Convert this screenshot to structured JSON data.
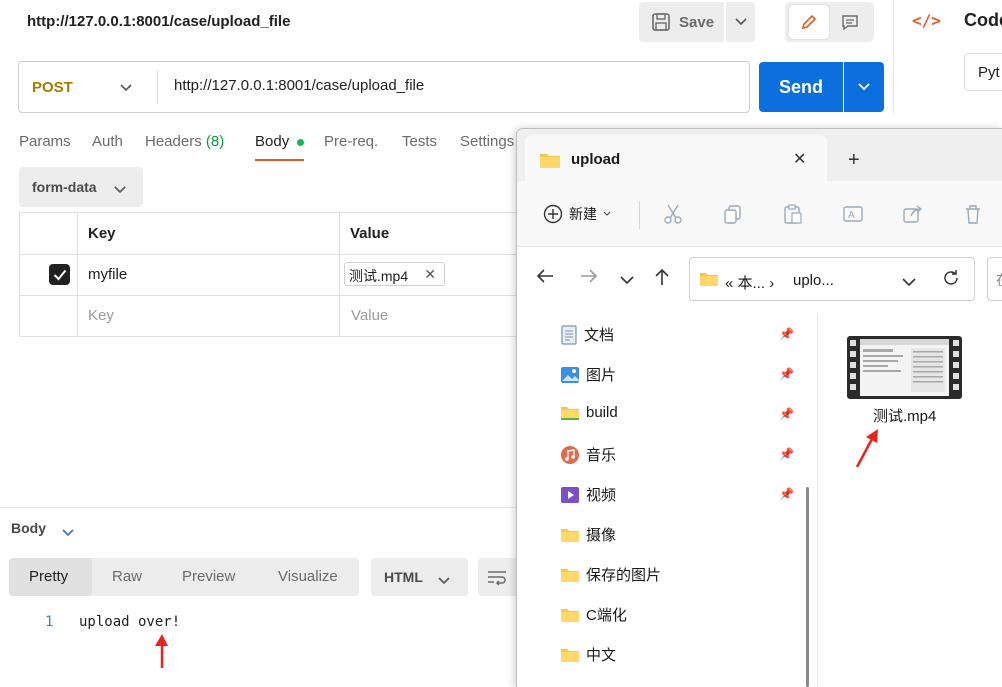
{
  "request": {
    "title": "http://127.0.0.1:8001/case/upload_file",
    "save_label": "Save",
    "method": "POST",
    "url": "http://127.0.0.1:8001/case/upload_file",
    "send_label": "Send"
  },
  "code_panel": {
    "label": "Code",
    "language": "Pyt"
  },
  "tabs": {
    "params": "Params",
    "auth": "Auth",
    "headers": "Headers",
    "headers_count": "(8)",
    "body": "Body",
    "prereq": "Pre-req.",
    "tests": "Tests",
    "settings": "Settings"
  },
  "body_mode": "form-data",
  "kv_table": {
    "header_key": "Key",
    "header_value": "Value",
    "rows": [
      {
        "key": "myfile",
        "value": "测试.mp4",
        "checked": true
      }
    ],
    "placeholder_key": "Key",
    "placeholder_value": "Value"
  },
  "response": {
    "label": "Body",
    "tabs": [
      "Pretty",
      "Raw",
      "Preview",
      "Visualize"
    ],
    "format": "HTML",
    "line_number": "1",
    "text": "upload over!"
  },
  "explorer": {
    "tab_title": "upload",
    "new_label": "新建",
    "breadcrumb": [
      "本...",
      "uplo..."
    ],
    "search_hint": "在",
    "nav_items": [
      {
        "label": "文档",
        "icon": "document-icon",
        "pinned": true
      },
      {
        "label": "图片",
        "icon": "pictures-icon",
        "pinned": true
      },
      {
        "label": "build",
        "icon": "folder-icon",
        "pinned": true
      },
      {
        "label": "音乐",
        "icon": "music-icon",
        "pinned": true
      },
      {
        "label": "视频",
        "icon": "video-icon",
        "pinned": true
      },
      {
        "label": "摄像",
        "icon": "folder-icon",
        "pinned": false
      },
      {
        "label": "保存的图片",
        "icon": "folder-icon",
        "pinned": false
      },
      {
        "label": "C端化",
        "icon": "folder-icon",
        "pinned": false
      },
      {
        "label": "中文",
        "icon": "folder-icon",
        "pinned": false
      }
    ],
    "file": {
      "name": "测试.mp4",
      "icon": "video-file-icon"
    }
  },
  "colors": {
    "send": "#0c6fde",
    "method": "#a57a00",
    "accent": "#e05b2a",
    "arrow": "#e8251b",
    "folder": "#f5c84c"
  }
}
